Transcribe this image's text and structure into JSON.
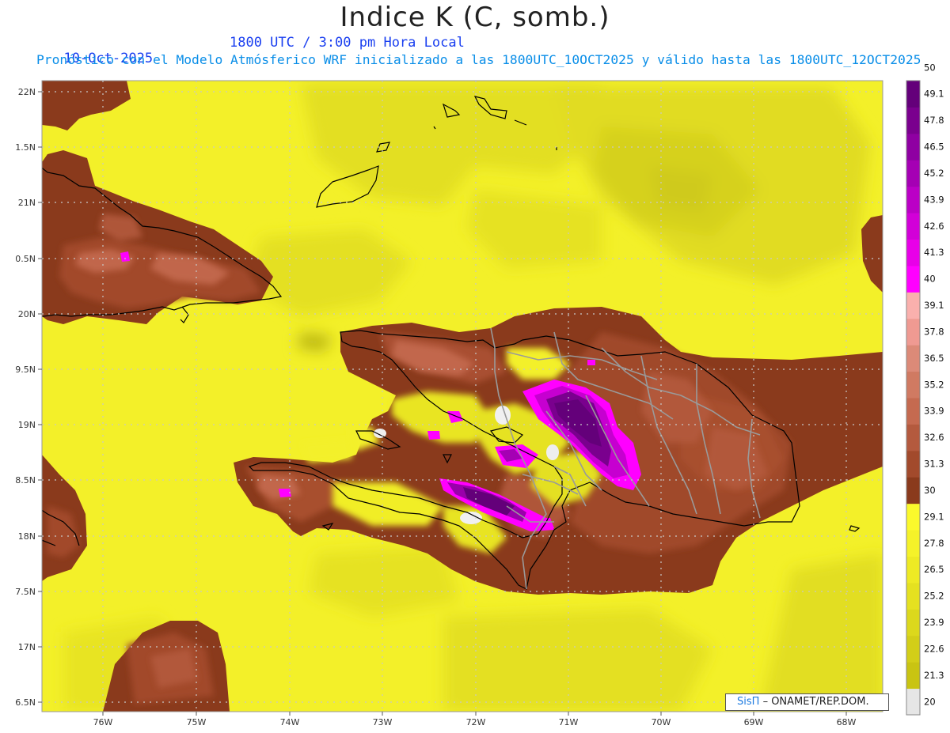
{
  "header": {
    "title": "Indice K (C, somb.)",
    "date": "10-Oct-2025",
    "time": "1800 UTC / 3:00 pm Hora Local",
    "forecast_note": "Pronóstico con el Modelo Atmósferico WRF inicializado a las 1800UTC_10OCT2025 y válido hasta las  1800UTC_12OCT2025"
  },
  "map": {
    "lat_labels": [
      "22N",
      "1.5N",
      "21N",
      "0.5N",
      "20N",
      "9.5N",
      "19N",
      "8.5N",
      "18N",
      "7.5N",
      "17N",
      "6.5N"
    ],
    "lon_labels": [
      "76W",
      "75W",
      "74W",
      "73W",
      "72W",
      "71W",
      "70W",
      "69W",
      "68W"
    ]
  },
  "legend": {
    "levels": [
      "20",
      "21.3",
      "22.6",
      "23.9",
      "25.2",
      "26.5",
      "27.8",
      "29.1",
      "30",
      "31.3",
      "32.6",
      "33.9",
      "35.2",
      "36.5",
      "37.8",
      "39.1",
      "40",
      "41.3",
      "42.6",
      "43.9",
      "45.2",
      "46.5",
      "47.8",
      "49.1",
      "50"
    ],
    "colors": [
      "#e6e6e6",
      "#c9c412",
      "#d3ce18",
      "#dcd81c",
      "#e5e120",
      "#eeea24",
      "#f5f229",
      "#fbf92c",
      "#8a3a1c",
      "#a24a2c",
      "#b45a3e",
      "#c56a50",
      "#d07a62",
      "#dc8a78",
      "#ef9a92",
      "#fab0ad",
      "#ff00ff",
      "#e800e8",
      "#d200d8",
      "#bb00c6",
      "#a500b4",
      "#8f00a2",
      "#7a008e",
      "#64007a"
    ]
  },
  "credit": {
    "brand": "SisΠ",
    "text": "– ONAMET/REP.DOM."
  }
}
